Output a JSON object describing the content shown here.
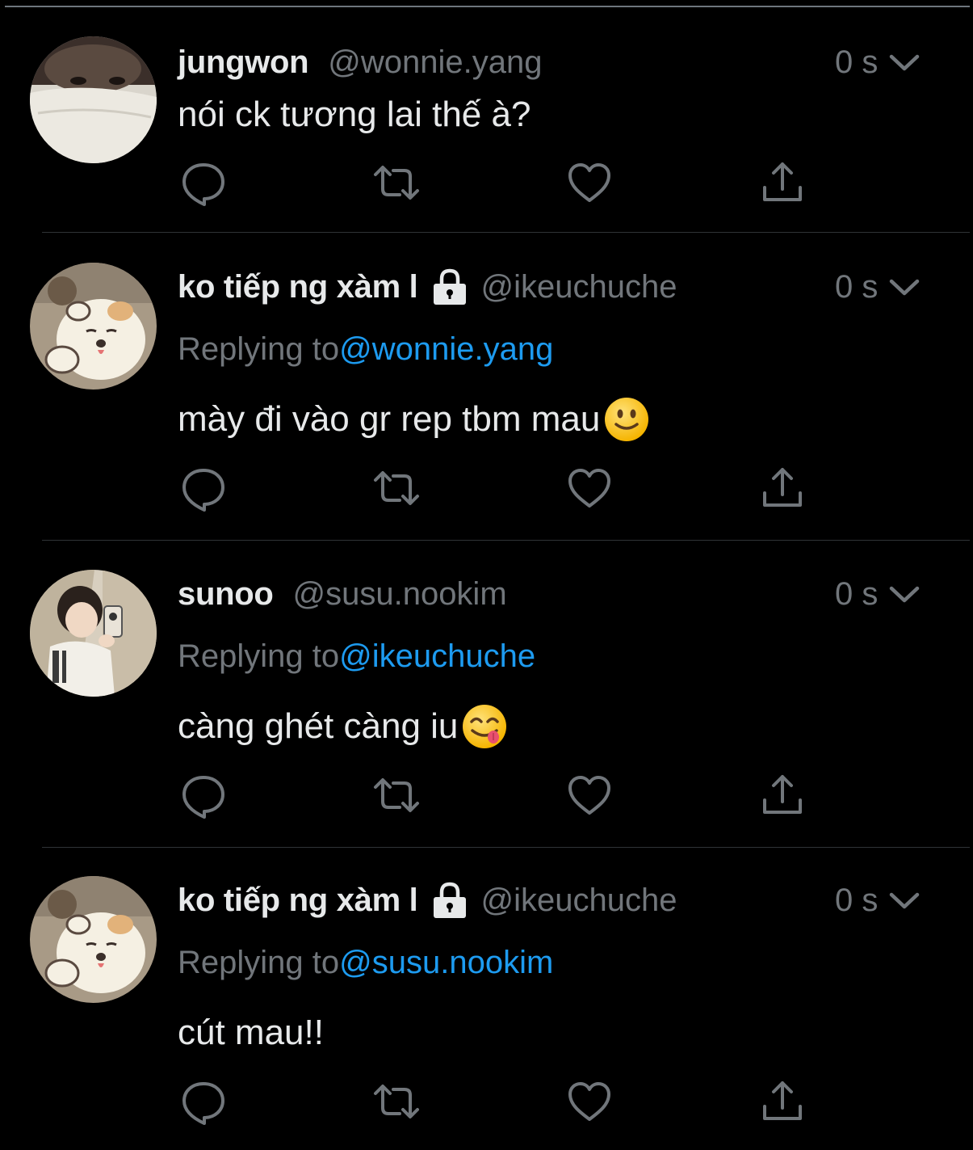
{
  "tweets": [
    {
      "name": "jungwon",
      "handle": "@wonnie.yang",
      "locked": false,
      "time": "0 s",
      "replying_label": "",
      "replying_to": "",
      "text": "nói ck tương lai thế à?",
      "emoji": ""
    },
    {
      "name": "ko tiếp ng xàm l",
      "handle": "@ikeuchuche",
      "locked": true,
      "time": "0 s",
      "replying_label": "Replying to",
      "replying_to": "@wonnie.yang",
      "text": "mày đi vào gr rep tbm mau",
      "emoji": "slightly-smiling-face"
    },
    {
      "name": "sunoo",
      "handle": "@susu.nookim",
      "locked": false,
      "time": "0 s",
      "replying_label": "Replying to",
      "replying_to": "@ikeuchuche",
      "text": "càng ghét càng iu",
      "emoji": "face-savoring-food"
    },
    {
      "name": "ko tiếp ng xàm l",
      "handle": "@ikeuchuche",
      "locked": true,
      "time": "0 s",
      "replying_label": "Replying to",
      "replying_to": "@susu.nookim",
      "text": "cút mau!!",
      "emoji": ""
    }
  ],
  "colors": {
    "background": "#000000",
    "text": "#e7e9ea",
    "muted": "#71767b",
    "link": "#1d9bf0",
    "divider": "#2f3336"
  },
  "icons": [
    "reply-icon",
    "retweet-icon",
    "like-icon",
    "share-icon",
    "lock-icon",
    "chevron-down-icon"
  ]
}
